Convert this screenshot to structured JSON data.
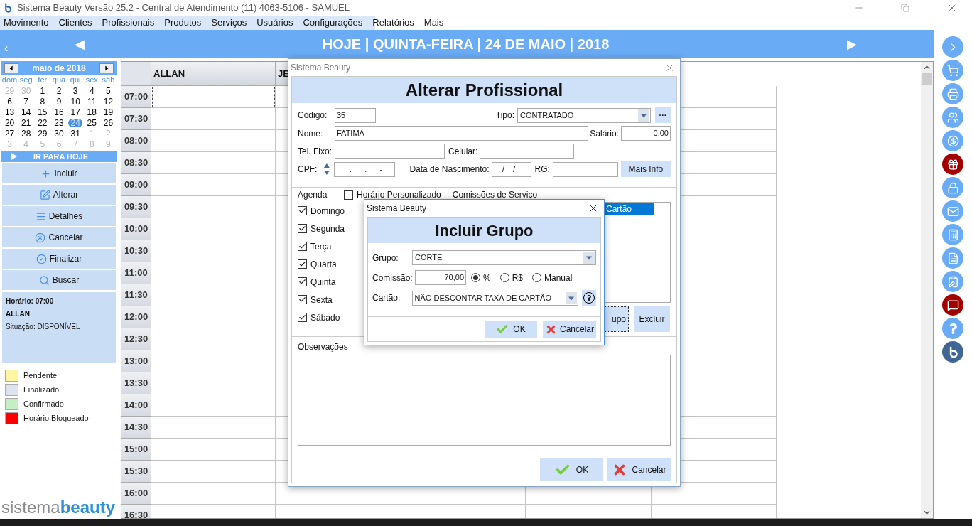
{
  "window": {
    "title": "Sistema Beauty Versão 25.2 - Central de Atendimento (11) 4063-5106 - SAMUEL"
  },
  "menu": [
    "Movimento",
    "Clientes",
    "Profissionais",
    "Produtos",
    "Serviços",
    "Usuários",
    "Configurações",
    "Relatórios",
    "Mais"
  ],
  "header": {
    "back": "‹",
    "prev": "◀",
    "title": "HOJE | QUINTA-FEIRA | 24 DE MAIO | 2018",
    "next": "▶"
  },
  "calendar": {
    "month": "maio de 2018",
    "weekdays": [
      "dom",
      "seg",
      "ter",
      "qua",
      "qui",
      "sex",
      "sáb"
    ],
    "days": [
      {
        "d": "29",
        "outside": true,
        "selected": false
      },
      {
        "d": "30",
        "outside": true,
        "selected": false
      },
      {
        "d": "1",
        "outside": false,
        "selected": false
      },
      {
        "d": "2",
        "outside": false,
        "selected": false
      },
      {
        "d": "3",
        "outside": false,
        "selected": false
      },
      {
        "d": "4",
        "outside": false,
        "selected": false
      },
      {
        "d": "5",
        "outside": false,
        "selected": false
      },
      {
        "d": "6",
        "outside": false,
        "selected": false
      },
      {
        "d": "7",
        "outside": false,
        "selected": false
      },
      {
        "d": "8",
        "outside": false,
        "selected": false
      },
      {
        "d": "9",
        "outside": false,
        "selected": false
      },
      {
        "d": "10",
        "outside": false,
        "selected": false
      },
      {
        "d": "11",
        "outside": false,
        "selected": false
      },
      {
        "d": "12",
        "outside": false,
        "selected": false
      },
      {
        "d": "13",
        "outside": false,
        "selected": false
      },
      {
        "d": "14",
        "outside": false,
        "selected": false
      },
      {
        "d": "15",
        "outside": false,
        "selected": false
      },
      {
        "d": "16",
        "outside": false,
        "selected": false
      },
      {
        "d": "17",
        "outside": false,
        "selected": false
      },
      {
        "d": "18",
        "outside": false,
        "selected": false
      },
      {
        "d": "19",
        "outside": false,
        "selected": false
      },
      {
        "d": "20",
        "outside": false,
        "selected": false
      },
      {
        "d": "21",
        "outside": false,
        "selected": false
      },
      {
        "d": "22",
        "outside": false,
        "selected": false
      },
      {
        "d": "23",
        "outside": false,
        "selected": false
      },
      {
        "d": "24",
        "outside": false,
        "selected": true
      },
      {
        "d": "25",
        "outside": false,
        "selected": false
      },
      {
        "d": "26",
        "outside": false,
        "selected": false
      },
      {
        "d": "27",
        "outside": false,
        "selected": false
      },
      {
        "d": "28",
        "outside": false,
        "selected": false
      },
      {
        "d": "29",
        "outside": false,
        "selected": false
      },
      {
        "d": "30",
        "outside": false,
        "selected": false
      },
      {
        "d": "31",
        "outside": false,
        "selected": false
      },
      {
        "d": "1",
        "outside": true,
        "selected": false
      },
      {
        "d": "2",
        "outside": true,
        "selected": false
      },
      {
        "d": "3",
        "outside": true,
        "selected": false
      },
      {
        "d": "4",
        "outside": true,
        "selected": false
      },
      {
        "d": "5",
        "outside": true,
        "selected": false
      },
      {
        "d": "6",
        "outside": true,
        "selected": false
      },
      {
        "d": "7",
        "outside": true,
        "selected": false
      },
      {
        "d": "8",
        "outside": true,
        "selected": false
      },
      {
        "d": "9",
        "outside": true,
        "selected": false
      }
    ],
    "today_button": "IR PARA HOJE"
  },
  "actions": [
    "Incluir",
    "Alterar",
    "Detalhes",
    "Cancelar",
    "Finalizar",
    "Buscar"
  ],
  "slot_info": {
    "time": "Horário: 07:00",
    "professional": "ALLAN",
    "status": "Situação: DISPONÍVEL"
  },
  "legend": [
    {
      "label": "Pendente",
      "color": "#fff5a5"
    },
    {
      "label": "Finalizado",
      "color": "#dde3ef"
    },
    {
      "label": "Confirmado",
      "color": "#c4eec4"
    },
    {
      "label": "Horário Bloqueado",
      "color": "#ff0000"
    }
  ],
  "logo": {
    "light": "sistema",
    "bold": "beauty"
  },
  "schedule": {
    "columns": [
      "ALLAN",
      "JE"
    ],
    "times": [
      "07:00",
      "07:30",
      "08:00",
      "08:30",
      "09:00",
      "09:30",
      "10:00",
      "10:30",
      "11:00",
      "11:30",
      "12:00",
      "12:30",
      "13:00",
      "13:30",
      "14:00",
      "14:30",
      "15:00",
      "15:30",
      "16:00",
      "16:30"
    ]
  },
  "quick_actions": [
    {
      "color": "#6aabf5"
    },
    {
      "color": "#6aabf5"
    },
    {
      "color": "#6aabf5"
    },
    {
      "color": "#6aabf5"
    },
    {
      "color": "#6aabf5"
    },
    {
      "color": "#a30000"
    },
    {
      "color": "#6aabf5"
    },
    {
      "color": "#6aabf5"
    },
    {
      "color": "#6aabf5"
    },
    {
      "color": "#6aabf5"
    },
    {
      "color": "#6aabf5"
    },
    {
      "color": "#a30000"
    },
    {
      "color": "#6aabf5"
    },
    {
      "color": "#3f6694"
    }
  ],
  "edit_dialog": {
    "window_title": "Sistema Beauty",
    "heading": "Alterar Profissional",
    "codigo_label": "Código:",
    "codigo": "35",
    "tipo_label": "Tipo:",
    "tipo": "CONTRATADO",
    "more_button": "···",
    "nome_label": "Nome:",
    "nome": "FATIMA",
    "salario_label": "Salário:",
    "salario": "0,00",
    "tel_label": "Tel. Fixo:",
    "celular_label": "Celular:",
    "cpf_label": "CPF:",
    "cpf": "___.___.___-__",
    "nascimento_label": "Data de Nascimento:",
    "nascimento": "__/__/__",
    "rg_label": "RG:",
    "mais_info": "Mais Info",
    "agenda_label": "Agenda",
    "custom_hours": {
      "label": "Horário Personalizado",
      "checked": false
    },
    "commissions_label": "Comissões de Serviço",
    "days": [
      {
        "label": "Domingo",
        "checked": true
      },
      {
        "label": "Segunda",
        "checked": true
      },
      {
        "label": "Terça",
        "checked": true
      },
      {
        "label": "Quarta",
        "checked": true
      },
      {
        "label": "Quinta",
        "checked": true
      },
      {
        "label": "Sexta",
        "checked": true
      },
      {
        "label": "Sábado",
        "checked": true
      }
    ],
    "table_column": "Cartão",
    "add_group_button": "upo",
    "delete_button": "Excluir",
    "notes_label": "Observações",
    "ok": "OK",
    "cancel": "Cancelar"
  },
  "group_dialog": {
    "window_title": "Sistema Beauty",
    "heading": "Incluir Grupo",
    "grupo_label": "Grupo:",
    "grupo": "CORTE",
    "comissao_label": "Comissão:",
    "comissao": "70,00",
    "commission_types": [
      {
        "label": "%",
        "selected": true
      },
      {
        "label": "R$",
        "selected": false
      },
      {
        "label": "Manual",
        "selected": false
      }
    ],
    "cartao_label": "Cartão:",
    "cartao": "NÃO DESCONTAR TAXA DE CARTÃO",
    "ok": "OK",
    "cancel": "Cancelar"
  }
}
